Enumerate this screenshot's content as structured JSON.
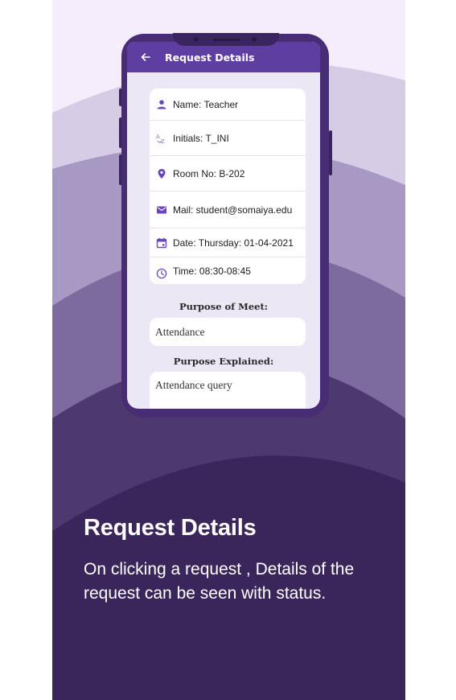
{
  "colors": {
    "background_top": "#f5ecfc",
    "wave_1": "#d7cce6",
    "wave_2": "#a898c4",
    "wave_3": "#7d6a9f",
    "wave_4": "#4d386f",
    "background_bottom": "#3b265c",
    "app_bar": "#5e3ea1",
    "icon_accent": "#6a47b8"
  },
  "screen": {
    "app_bar": {
      "back_icon": "arrow-left-icon",
      "title": "Request Details"
    },
    "details": [
      {
        "icon": "person-icon",
        "text": "Name: Teacher"
      },
      {
        "icon": "sort-alpha-icon",
        "text": "Initials: T_INI"
      },
      {
        "icon": "location-pin-icon",
        "text": "Room No: B-202"
      },
      {
        "icon": "mail-icon",
        "text": "Mail: student@somaiya.edu"
      },
      {
        "icon": "calendar-icon",
        "text": "Date: Thursday: 01-04-2021"
      },
      {
        "icon": "clock-icon",
        "text": "Time: 08:30-08:45"
      }
    ],
    "purpose_label": "Purpose of Meet:",
    "purpose_value": "Attendance",
    "explained_label": "Purpose Explained:",
    "explained_value": "Attendance query"
  },
  "caption": {
    "title": "Request Details",
    "description": "On clicking a request , Details of the request can be seen with status."
  }
}
